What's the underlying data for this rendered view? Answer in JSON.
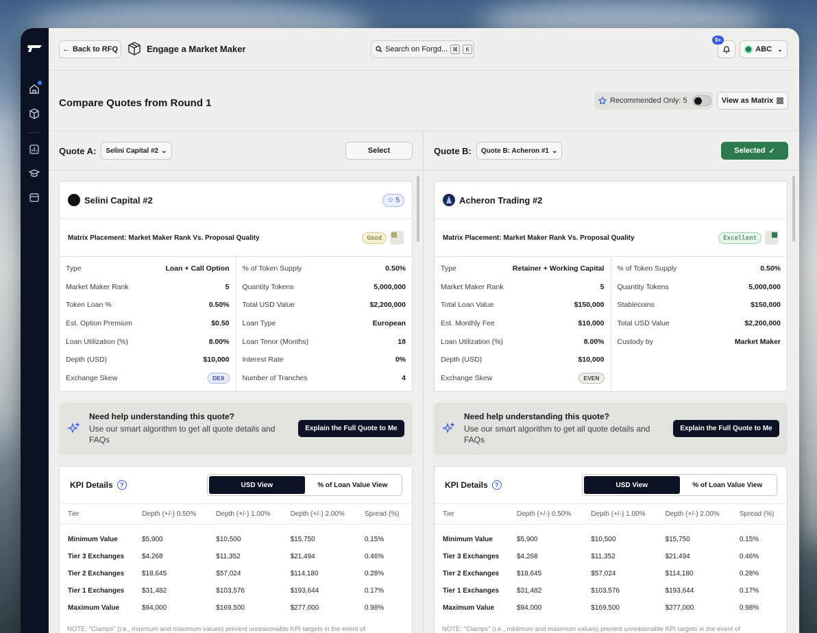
{
  "header": {
    "back_label": "Back to RFQ",
    "title": "Engage a Market Maker",
    "search_placeholder": "Search on Forgd...",
    "kbd_1": "⌘",
    "kbd_2": "K",
    "notif_count": "9+",
    "account": "ABC"
  },
  "compare": {
    "title": "Compare Quotes from Round 1",
    "recommended_label": "Recommended Only: 5",
    "matrix_label": "View as Matrix"
  },
  "quotes": [
    {
      "slot_label": "Quote A:",
      "selector": "Selini Capital #2",
      "select_label": "Select",
      "name": "Selini Capital #2",
      "stars": "5",
      "matrix_label": "Matrix Placement: Market Maker Rank Vs. Proposal Quality",
      "quality": "Good",
      "left": [
        {
          "k": "Type",
          "v": "Loan + Call Option"
        },
        {
          "k": "Market Maker Rank",
          "v": "5"
        },
        {
          "k": "Token Loan %",
          "v": "0.50%"
        },
        {
          "k": "Est. Option Premium",
          "v": "$0.50"
        },
        {
          "k": "Loan Utilization (%)",
          "v": "8.00%"
        },
        {
          "k": "Depth (USD)",
          "v": "$10,000"
        },
        {
          "k": "Exchange Skew",
          "v": "DEX",
          "tag": "dex"
        }
      ],
      "right": [
        {
          "k": "% of Token Supply",
          "v": "0.50%"
        },
        {
          "k": "Quantity Tokens",
          "v": "5,000,000"
        },
        {
          "k": "Total USD Value",
          "v": "$2,200,000"
        },
        {
          "k": "Loan Type",
          "v": "European"
        },
        {
          "k": "Loan Tenor (Months)",
          "v": "18"
        },
        {
          "k": "Interest Rate",
          "v": "0%"
        },
        {
          "k": "Number of Tranches",
          "v": "4"
        }
      ]
    },
    {
      "slot_label": "Quote B:",
      "selector": "Quote B: Acheron #1",
      "select_label": "Selected",
      "name": "Acheron Trading #2",
      "matrix_label": "Matrix Placement: Market Maker Rank Vs. Proposal Quality",
      "quality": "Excellent",
      "left": [
        {
          "k": "Type",
          "v": "Retainer + Working Capital"
        },
        {
          "k": "Market Maker Rank",
          "v": "5"
        },
        {
          "k": "Total Loan Value",
          "v": "$150,000"
        },
        {
          "k": "Est. Monthly Fee",
          "v": "$10,000"
        },
        {
          "k": "Loan Utilization (%)",
          "v": "8.00%"
        },
        {
          "k": "Depth (USD)",
          "v": "$10,000"
        },
        {
          "k": "Exchange Skew",
          "v": "EVEN",
          "tag": "even"
        }
      ],
      "right": [
        {
          "k": "% of Token Supply",
          "v": "0.50%"
        },
        {
          "k": "Quantity Tokens",
          "v": "5,000,000"
        },
        {
          "k": "Stablecoins",
          "v": "$150,000"
        },
        {
          "k": "Total USD Value",
          "v": "$2,200,000"
        },
        {
          "k": "Custody by",
          "v": "Market Maker"
        }
      ]
    }
  ],
  "help": {
    "title": "Need help understanding this quote?",
    "body": "Use our smart algorithm to get all quote details and FAQs",
    "button": "Explain the Full Quote to Me"
  },
  "kpi": {
    "title": "KPI Details",
    "usd_view": "USD View",
    "pct_view": "% of Loan Value View",
    "columns": [
      "Tier",
      "Depth (+/-) 0.50%",
      "Depth (+/-) 1.00%",
      "Depth (+/-) 2.00%",
      "Spread (%)"
    ],
    "rows": [
      [
        "Minimum Value",
        "$5,900",
        "$10,500",
        "$15,750",
        "0.15%"
      ],
      [
        "Tier 3 Exchanges",
        "$4,268",
        "$11,352",
        "$21,494",
        "0.46%"
      ],
      [
        "Tier 2 Exchanges",
        "$18,645",
        "$57,024",
        "$114,180",
        "0.28%"
      ],
      [
        "Tier 1 Exchanges",
        "$31,482",
        "$103,576",
        "$193,644",
        "0.17%"
      ],
      [
        "Maximum Value",
        "$94,000",
        "$169,500",
        "$277,000",
        "0.98%"
      ]
    ],
    "note": "NOTE: \"Clamps\" (i.e., minimum and maximum values) prevent unreasonable KPI targets in the event of"
  }
}
